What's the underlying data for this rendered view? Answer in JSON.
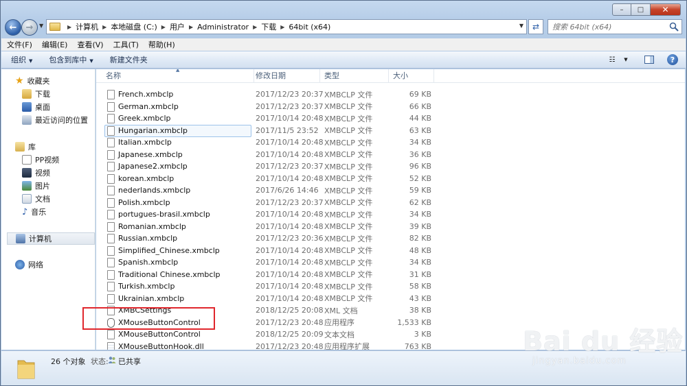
{
  "window": {
    "caption": {
      "minimize": "–",
      "maximize": "□",
      "close": "✕"
    }
  },
  "nav": {
    "breadcrumb": [
      "计算机",
      "本地磁盘 (C:)",
      "用户",
      "Administrator",
      "下载",
      "64bit (x64)"
    ],
    "search_placeholder": "搜索 64bit (x64)"
  },
  "menubar": {
    "items": [
      "文件(F)",
      "编辑(E)",
      "查看(V)",
      "工具(T)",
      "帮助(H)"
    ]
  },
  "toolbar": {
    "organize": "组织",
    "include_library": "包含到库中",
    "new_folder": "新建文件夹"
  },
  "navpane": {
    "favorites": "收藏夹",
    "downloads": "下载",
    "desktop": "桌面",
    "recent": "最近访问的位置",
    "libraries": "库",
    "pp_video": "PP视频",
    "videos": "视频",
    "pictures": "图片",
    "documents": "文档",
    "music": "音乐",
    "computer": "计算机",
    "network": "网络"
  },
  "columns": {
    "name": "名称",
    "date": "修改日期",
    "type": "类型",
    "size": "大小"
  },
  "files": [
    {
      "name": "French.xmbclp",
      "date": "2017/12/23 20:37",
      "type": "XMBCLP 文件",
      "size": "69 KB",
      "icon": "file"
    },
    {
      "name": "German.xmbclp",
      "date": "2017/12/23 20:37",
      "type": "XMBCLP 文件",
      "size": "66 KB",
      "icon": "file"
    },
    {
      "name": "Greek.xmbclp",
      "date": "2017/10/14 20:48",
      "type": "XMBCLP 文件",
      "size": "44 KB",
      "icon": "file"
    },
    {
      "name": "Hungarian.xmbclp",
      "date": "2017/11/5 23:52",
      "type": "XMBCLP 文件",
      "size": "63 KB",
      "icon": "file"
    },
    {
      "name": "Italian.xmbclp",
      "date": "2017/10/14 20:48",
      "type": "XMBCLP 文件",
      "size": "34 KB",
      "icon": "file"
    },
    {
      "name": "Japanese.xmbclp",
      "date": "2017/10/14 20:48",
      "type": "XMBCLP 文件",
      "size": "36 KB",
      "icon": "file"
    },
    {
      "name": "Japanese2.xmbclp",
      "date": "2017/12/23 20:37",
      "type": "XMBCLP 文件",
      "size": "96 KB",
      "icon": "file"
    },
    {
      "name": "korean.xmbclp",
      "date": "2017/10/14 20:48",
      "type": "XMBCLP 文件",
      "size": "52 KB",
      "icon": "file"
    },
    {
      "name": "nederlands.xmbclp",
      "date": "2017/6/26 14:46",
      "type": "XMBCLP 文件",
      "size": "59 KB",
      "icon": "file"
    },
    {
      "name": "Polish.xmbclp",
      "date": "2017/12/23 20:37",
      "type": "XMBCLP 文件",
      "size": "62 KB",
      "icon": "file"
    },
    {
      "name": "portugues-brasil.xmbclp",
      "date": "2017/10/14 20:48",
      "type": "XMBCLP 文件",
      "size": "34 KB",
      "icon": "file"
    },
    {
      "name": "Romanian.xmbclp",
      "date": "2017/10/14 20:48",
      "type": "XMBCLP 文件",
      "size": "39 KB",
      "icon": "file"
    },
    {
      "name": "Russian.xmbclp",
      "date": "2017/12/23 20:36",
      "type": "XMBCLP 文件",
      "size": "82 KB",
      "icon": "file"
    },
    {
      "name": "Simplified_Chinese.xmbclp",
      "date": "2017/10/14 20:48",
      "type": "XMBCLP 文件",
      "size": "48 KB",
      "icon": "file"
    },
    {
      "name": "Spanish.xmbclp",
      "date": "2017/10/14 20:48",
      "type": "XMBCLP 文件",
      "size": "34 KB",
      "icon": "file"
    },
    {
      "name": "Traditional Chinese.xmbclp",
      "date": "2017/10/14 20:48",
      "type": "XMBCLP 文件",
      "size": "31 KB",
      "icon": "file"
    },
    {
      "name": "Turkish.xmbclp",
      "date": "2017/10/14 20:48",
      "type": "XMBCLP 文件",
      "size": "58 KB",
      "icon": "file"
    },
    {
      "name": "Ukrainian.xmbclp",
      "date": "2017/10/14 20:48",
      "type": "XMBCLP 文件",
      "size": "43 KB",
      "icon": "file"
    },
    {
      "name": "XMBCSettings",
      "date": "2018/12/25 20:08",
      "type": "XML 文档",
      "size": "38 KB",
      "icon": "file"
    },
    {
      "name": "XMouseButtonControl",
      "date": "2017/12/23 20:48",
      "type": "应用程序",
      "size": "1,533 KB",
      "icon": "exe"
    },
    {
      "name": "XMouseButtonControl",
      "date": "2018/12/25 20:09",
      "type": "文本文档",
      "size": "3 KB",
      "icon": "file"
    },
    {
      "name": "XMouseButtonHook.dll",
      "date": "2017/12/23 20:48",
      "type": "应用程序扩展",
      "size": "763 KB",
      "icon": "dll"
    }
  ],
  "status": {
    "count": "26 个对象",
    "state_label": "状态:",
    "shared": "已共享"
  },
  "watermark": {
    "main": "Bai du 经验",
    "sub": "jingyan.baidu.com"
  }
}
